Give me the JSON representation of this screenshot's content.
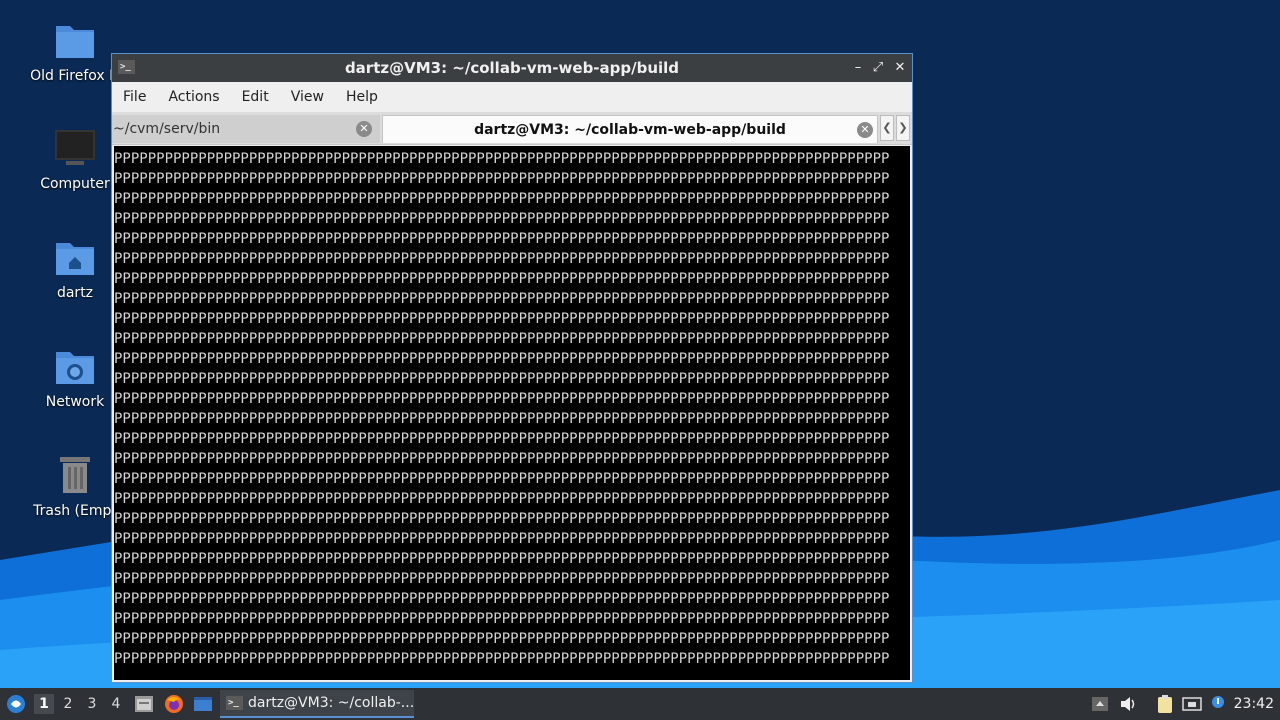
{
  "desktop": {
    "icons": [
      {
        "label": "Old Firefox D",
        "icon": "folder-icon"
      },
      {
        "label": "Computer",
        "icon": "computer-icon"
      },
      {
        "label": "dartz",
        "icon": "home-folder-icon"
      },
      {
        "label": "Network",
        "icon": "network-folder-icon"
      },
      {
        "label": "Trash (Empt",
        "icon": "trash-icon"
      }
    ]
  },
  "window": {
    "title": "dartz@VM3: ~/collab-vm-web-app/build",
    "menu": [
      "File",
      "Actions",
      "Edit",
      "View",
      "Help"
    ],
    "tabs": [
      {
        "label": "~/cvm/serv/bin",
        "active": false
      },
      {
        "label": "dartz@VM3: ~/collab-vm-web-app/build",
        "active": true
      }
    ],
    "terminal_line": "PPPPPPPPPPPPPPPPPPPPPPPPPPPPPPPPPPPPPPPPPPPPPPPPPPPPPPPPPPPPPPPPPPPPPPPPPPPPPPPPPPPPPPPPPPPPPPPPPPPP",
    "terminal_line_count": 26
  },
  "taskbar": {
    "workspaces": [
      "1",
      "2",
      "3",
      "4"
    ],
    "active_workspace": "1",
    "task_label": "dartz@VM3: ~/collab-...",
    "clock": "23:42"
  },
  "colors": {
    "accent": "#5a8fd0",
    "titlebar": "#3c3f41",
    "taskbar": "#2e3236"
  }
}
